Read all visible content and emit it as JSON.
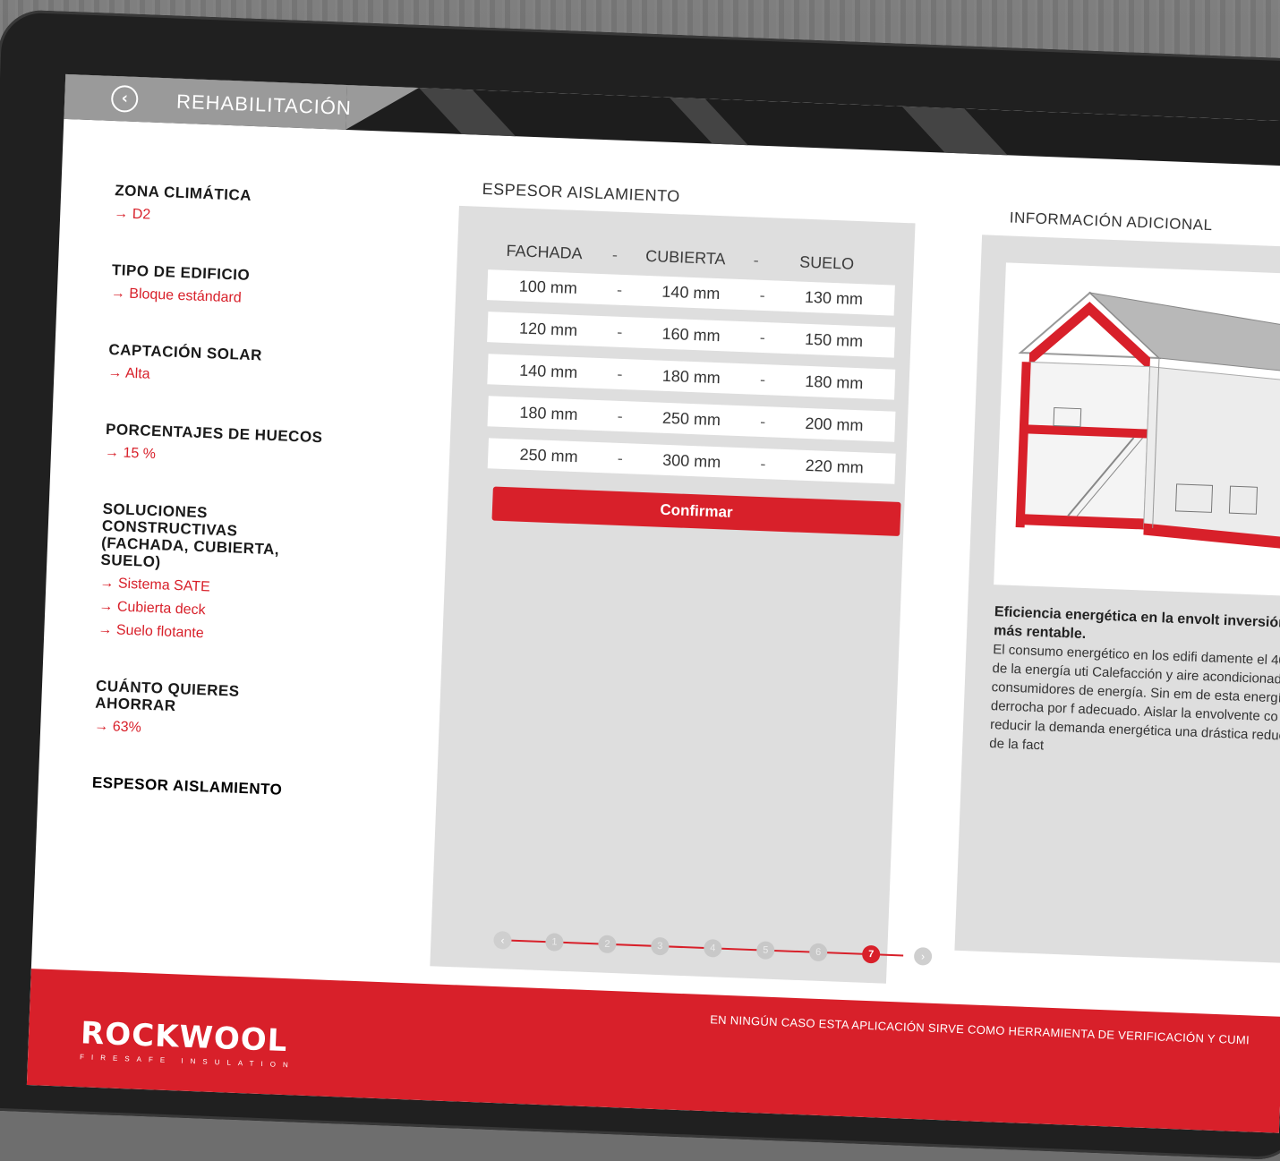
{
  "header": {
    "title": "REHABILITACIÓN",
    "back_icon": "chevron-left-icon"
  },
  "sidebar": [
    {
      "label": "ZONA CLIMÁTICA",
      "values": [
        "→ D2"
      ]
    },
    {
      "label": "TIPO DE EDIFICIO",
      "values": [
        "→ Bloque estándard"
      ]
    },
    {
      "label": "CAPTACIÓN SOLAR",
      "values": [
        "→ Alta"
      ]
    },
    {
      "label": "PORCENTAJES DE HUECOS",
      "values": [
        "→ 15 %"
      ]
    },
    {
      "label": "SOLUCIONES CONSTRUCTIVAS (FACHADA, CUBIERTA, SUELO)",
      "values": [
        "→ Sistema SATE",
        "→ Cubierta deck",
        "→ Suelo flotante"
      ]
    },
    {
      "label": "CUÁNTO QUIERES AHORRAR",
      "values": [
        "→ 63%"
      ]
    },
    {
      "label": "ESPESOR AISLAMIENTO",
      "values": []
    }
  ],
  "middle": {
    "title": "ESPESOR AISLAMIENTO",
    "columns": [
      "FACHADA",
      "CUBIERTA",
      "SUELO"
    ],
    "separator": "-",
    "rows": [
      [
        "100 mm",
        "140 mm",
        "130 mm"
      ],
      [
        "120 mm",
        "160 mm",
        "150 mm"
      ],
      [
        "140 mm",
        "180 mm",
        "180 mm"
      ],
      [
        "180 mm",
        "250 mm",
        "200 mm"
      ],
      [
        "250 mm",
        "300 mm",
        "220 mm"
      ]
    ],
    "confirm_label": "Confirmar",
    "steps": [
      "1",
      "2",
      "3",
      "4",
      "5",
      "6",
      "7"
    ],
    "active_step": 7
  },
  "right": {
    "title": "INFORMACIÓN ADICIONAL",
    "info_heading": "Eficiencia energética en la envolt inversión más rentable.",
    "info_body": "El consumo energético en los edifi damente el 40% de la energía uti Calefacción y aire acondicionado consumidores de energía. Sin em de esta energía se derrocha por f adecuado. Aislar la envolvente co te reducir la demanda energética una drástica reducción de la fact"
  },
  "footer": {
    "disclaimer": "EN NINGÚN CASO ESTA APLICACIÓN SIRVE COMO HERRAMIENTA DE VERIFICACIÓN Y CUMI",
    "logo_text": "ROCKWOOL",
    "logo_sub": "FIRESAFE INSULATION"
  },
  "colors": {
    "accent": "#d8202a",
    "panel": "#dedede"
  }
}
